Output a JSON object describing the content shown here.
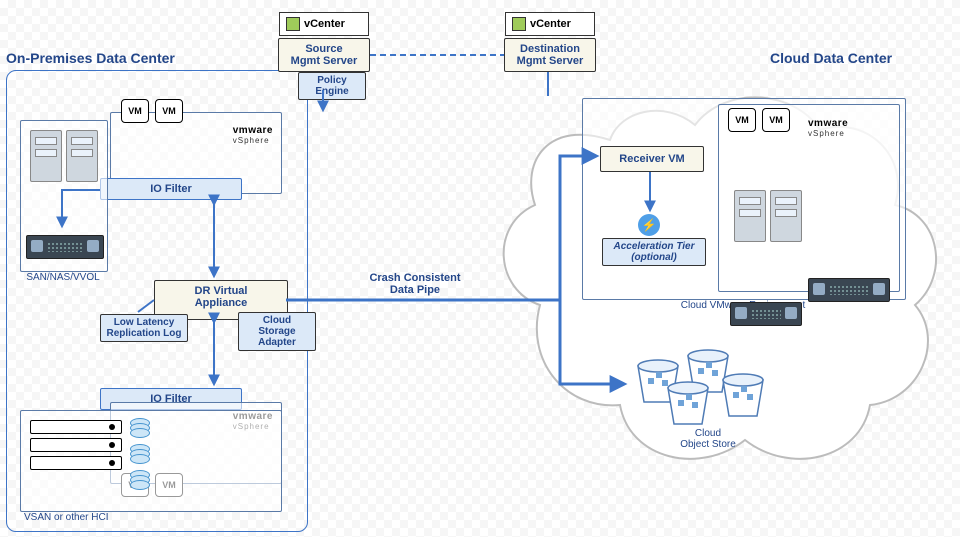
{
  "onprem": {
    "title": "On-Premises Data Center",
    "vcenter_label": "vCenter",
    "source_mgmt": "Source\nMgmt Server",
    "policy_engine": "Policy Engine",
    "io_filter": "IO Filter",
    "dr_appliance": "DR Virtual\nAppliance",
    "low_latency": "Low Latency\nReplication Log",
    "cloud_adapter": "Cloud Storage\nAdapter",
    "san_label": "SAN/NAS/VVOL",
    "vsan_label": "VSAN or other HCI",
    "vmware": "vmware",
    "vsphere": "vSphere",
    "vm": "VM"
  },
  "pipe_label": "Crash Consistent\nData Pipe",
  "cloud": {
    "title": "Cloud Data Center",
    "vcenter_label": "vCenter",
    "dest_mgmt": "Destination\nMgmt Server",
    "receiver": "Receiver VM",
    "accel_tier": "Acceleration Tier\n(optional)",
    "env_label": "Cloud VMware Environment",
    "obj_store": "Cloud\nObject Store",
    "vmware": "vmware",
    "vsphere": "vSphere",
    "vm": "VM"
  }
}
